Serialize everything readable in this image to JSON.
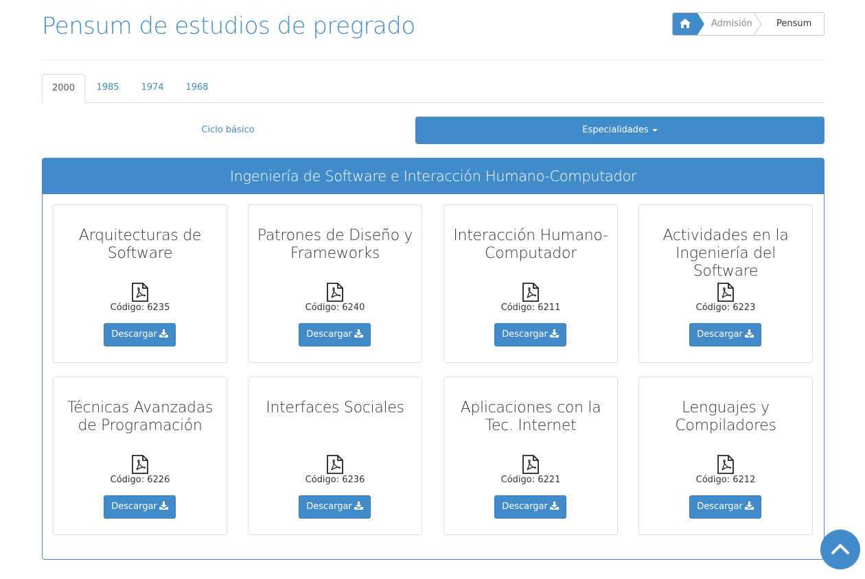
{
  "page": {
    "title": "Pensum de estudios de pregrado"
  },
  "breadcrumb": {
    "home_icon": "home-icon",
    "items": [
      "Admisión",
      "Pensum"
    ]
  },
  "tabs": {
    "items": [
      "2000",
      "1985",
      "1974",
      "1968"
    ],
    "active": "2000"
  },
  "pills": {
    "basic": "Ciclo básico",
    "specialties": "Especialidades"
  },
  "panel": {
    "heading": "Ingeniería de Software e Interacción Humano-Computador"
  },
  "courses": [
    {
      "title": "Arquitecturas de Software",
      "code": "Código: 6235",
      "button": "Descargar"
    },
    {
      "title": "Patrones de Diseño y Frameworks",
      "code": "Código: 6240",
      "button": "Descargar"
    },
    {
      "title": "Interacción Humano-Computador",
      "code": "Código: 6211",
      "button": "Descargar"
    },
    {
      "title": "Actividades en la Ingeniería del Software",
      "code": "Código: 6223",
      "button": "Descargar"
    },
    {
      "title": "Técnicas Avanzadas de Programación",
      "code": "Código: 6226",
      "button": "Descargar"
    },
    {
      "title": "Interfaces Sociales",
      "code": "Código: 6236",
      "button": "Descargar"
    },
    {
      "title": "Aplicaciones con la Tec. Internet",
      "code": "Código: 6221",
      "button": "Descargar"
    },
    {
      "title": "Lenguajes y Compiladores",
      "code": "Código: 6212",
      "button": "Descargar"
    }
  ],
  "icons": {
    "file": "pdf-file-icon",
    "download": "download-icon",
    "scroll_top": "chevron-up-icon"
  },
  "colors": {
    "primary": "#428bca",
    "border": "#dddddd"
  }
}
